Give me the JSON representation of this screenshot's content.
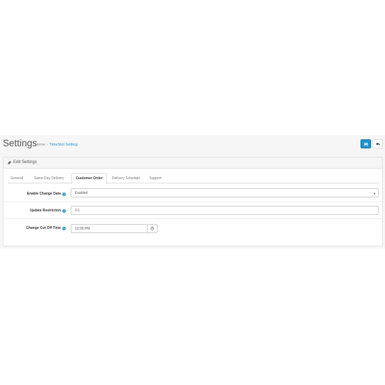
{
  "header": {
    "title": "Settings",
    "breadcrumbs": [
      "Home",
      "TimeSlot Setting"
    ],
    "breadcrumb_separator": "›",
    "buttons": {
      "save_icon": "save-icon",
      "back_icon": "reply-icon"
    }
  },
  "panel": {
    "title": "Edit Settings",
    "title_icon": "pencil-icon"
  },
  "tabs": [
    {
      "label": "General",
      "active": false
    },
    {
      "label": "Same Day Delivery",
      "active": false
    },
    {
      "label": "Customer Order",
      "active": true
    },
    {
      "label": "Delivery Schedule",
      "active": false
    },
    {
      "label": "Support",
      "active": false
    }
  ],
  "form": {
    "enable_change_date": {
      "label": "Enable Change Date",
      "value": "Enabled",
      "options_selected": "Enabled"
    },
    "update_restriction": {
      "label": "Update Restriction",
      "value": "2:1"
    },
    "change_cut_off_time": {
      "label": "Change Cut Off Time",
      "value": "12:00 PM"
    }
  },
  "colors": {
    "accent": "#1e91cf",
    "background": "#f6f6f6"
  }
}
